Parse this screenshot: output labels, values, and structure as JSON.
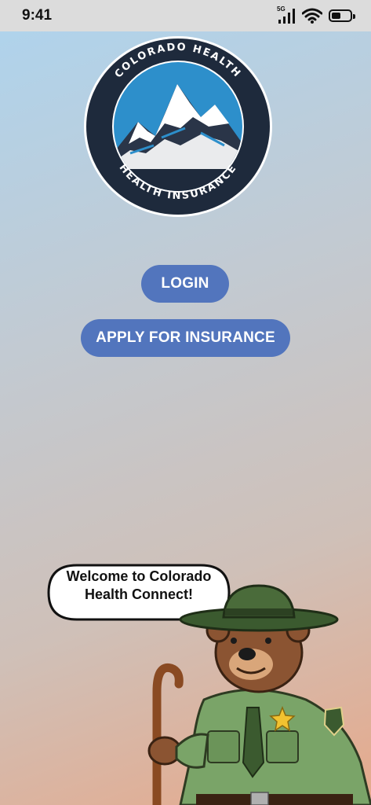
{
  "status_bar": {
    "time": "9:41",
    "network_label": "5G",
    "icons": [
      "signal-icon",
      "wifi-icon",
      "battery-icon"
    ]
  },
  "logo": {
    "top_text": "COLORADO HEALTH",
    "bottom_text": "HEALTH INSURANCE",
    "colors": {
      "ring": "#1e2a3c",
      "sky": "#2d8fcb",
      "snow": "#ffffff"
    }
  },
  "actions": {
    "login_label": "LOGIN",
    "apply_label": "APPLY FOR INSURANCE",
    "button_color": "#5275bd"
  },
  "mascot": {
    "speech_line1": "Welcome to Colorado",
    "speech_line2": "Health Connect!"
  }
}
